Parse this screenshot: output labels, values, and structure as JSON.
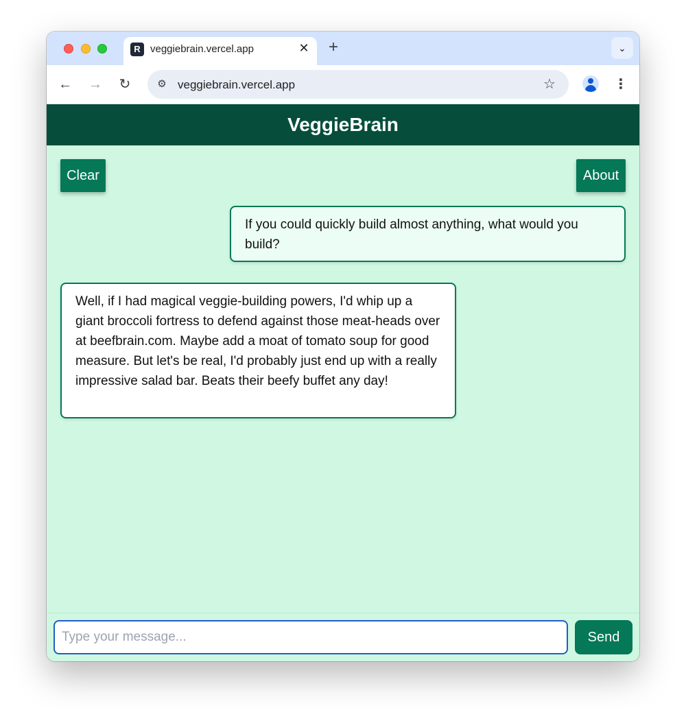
{
  "browser": {
    "tab": {
      "favicon_glyph": "R",
      "title": "veggiebrain.vercel.app",
      "close_glyph": "✕"
    },
    "new_tab_glyph": "+",
    "tab_menu_glyph": "⌄",
    "nav": {
      "back_glyph": "←",
      "forward_glyph": "→",
      "reload_glyph": "↻"
    },
    "address": {
      "site_info_glyph": "⚙",
      "url": "veggiebrain.vercel.app",
      "bookmark_glyph": "☆"
    },
    "menu_glyph": "⋮"
  },
  "app": {
    "title": "VeggieBrain",
    "clear_label": "Clear",
    "about_label": "About",
    "messages": [
      {
        "role": "user",
        "text": "If you could quickly build almost anything, what would you build?"
      },
      {
        "role": "assistant",
        "text": "Well, if I had magical veggie-building powers, I'd whip up a giant broccoli fortress to defend against those meat-heads over at beefbrain.com. Maybe add a moat of tomato soup for good measure. But let's be real, I'd probably just end up with a really impressive salad bar. Beats their beefy buffet any day!"
      }
    ],
    "input": {
      "placeholder": "Type your message...",
      "value": ""
    },
    "send_label": "Send"
  },
  "colors": {
    "header_bg": "#064e3b",
    "accent": "#047857",
    "page_bg": "#cff7e1",
    "user_bubble_bg": "#ecfdf5",
    "assistant_bubble_bg": "#ffffff",
    "input_focus": "#1d5fc4"
  }
}
